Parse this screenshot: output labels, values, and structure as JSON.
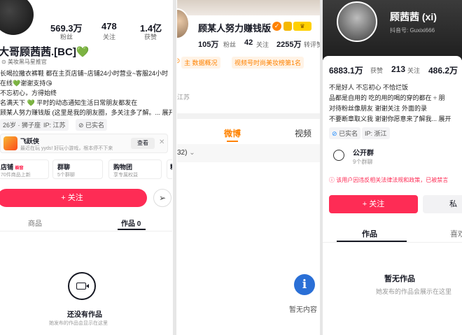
{
  "panel1": {
    "stats": [
      {
        "value": "569.3万",
        "label": "粉丝"
      },
      {
        "value": "478",
        "label": "关注"
      },
      {
        "value": "1.4亿",
        "label": "获赞"
      }
    ],
    "name": "大哥顾茜茜.[BC]",
    "subtitle": "美妆黑马星推官",
    "bio": [
      "长喝拉撒衣裤鞋 都在主页店铺~店铺24小时营业~客服24小时",
      "在线💚谢谢支持😘",
      "不忘初心，方得始终",
      "名满天下 💚 平时的动态通知生活日常朋友都发在",
      "顾某人努力赚钱版 (这里是我的朋友圈，多关注多了解。... 展开"
    ],
    "tags": [
      "26岁 · 狮子座",
      "IP: 江苏",
      "已实名"
    ],
    "game": {
      "name": "飞跃侠",
      "desc": "最近在玩 yyds! 好玩小游戏，根本停不下来",
      "button": "查看"
    },
    "shortcuts": [
      {
        "title": "店铺",
        "badge": "橱窗",
        "sub": "70件商品上新"
      },
      {
        "title": "群聊",
        "sub": "5个群聊"
      },
      {
        "title": "购物团",
        "sub": "享专属权益"
      },
      {
        "title": "粉",
        "sub": ""
      }
    ],
    "follow": "+ 关注",
    "tabs": [
      "商品",
      "作品 0"
    ],
    "empty_title": "还没有作品",
    "empty_sub": "她发布的作品会显示在这里"
  },
  "panel2": {
    "name": "顾某人努力赚钱版",
    "stats": [
      {
        "value": "105万",
        "label": "粉丝"
      },
      {
        "value": "42",
        "label": "关注"
      },
      {
        "value": "2255万",
        "label": "转评赞"
      }
    ],
    "badges": [
      "主 数据概况",
      "视频号时尚美妆榜第1名"
    ],
    "location": "江苏",
    "tabs": [
      "微博",
      "视频"
    ],
    "filter": "32)",
    "empty": "暂无内容"
  },
  "panel3": {
    "name": "顾茜茜 (xi)",
    "douyin_id": "抖音号: Guxixi666",
    "stats": [
      {
        "value": "6883.1万",
        "label": "获赞"
      },
      {
        "value": "213",
        "label": "关注"
      },
      {
        "value": "486.2万",
        "label": ""
      }
    ],
    "bio": [
      "不是好人 不忘初心 不恰烂饭",
      "品都是自用的 吃的用的喝的穿的都在 ÷ 朋",
      " 对待粉丝像朋友 谢谢关注     外面的录",
      "不要断章取义我 谢谢你愿意来了解我... 展开"
    ],
    "tags": [
      "已实名",
      "IP: 浙江"
    ],
    "group": {
      "title": "公开群",
      "sub": "9个群聊"
    },
    "warning": "该用户因违反相关法律法规和政策，已被禁言",
    "follow": "+ 关注",
    "follow2": "私",
    "tabs": [
      "作品",
      "喜欢"
    ],
    "empty_title": "暂无作品",
    "empty_sub": "她发布的作品会展示在这里"
  },
  "colors": {
    "accent": "#fe2c55",
    "weibo": "#ff8200",
    "green": "#3dbf2a"
  }
}
